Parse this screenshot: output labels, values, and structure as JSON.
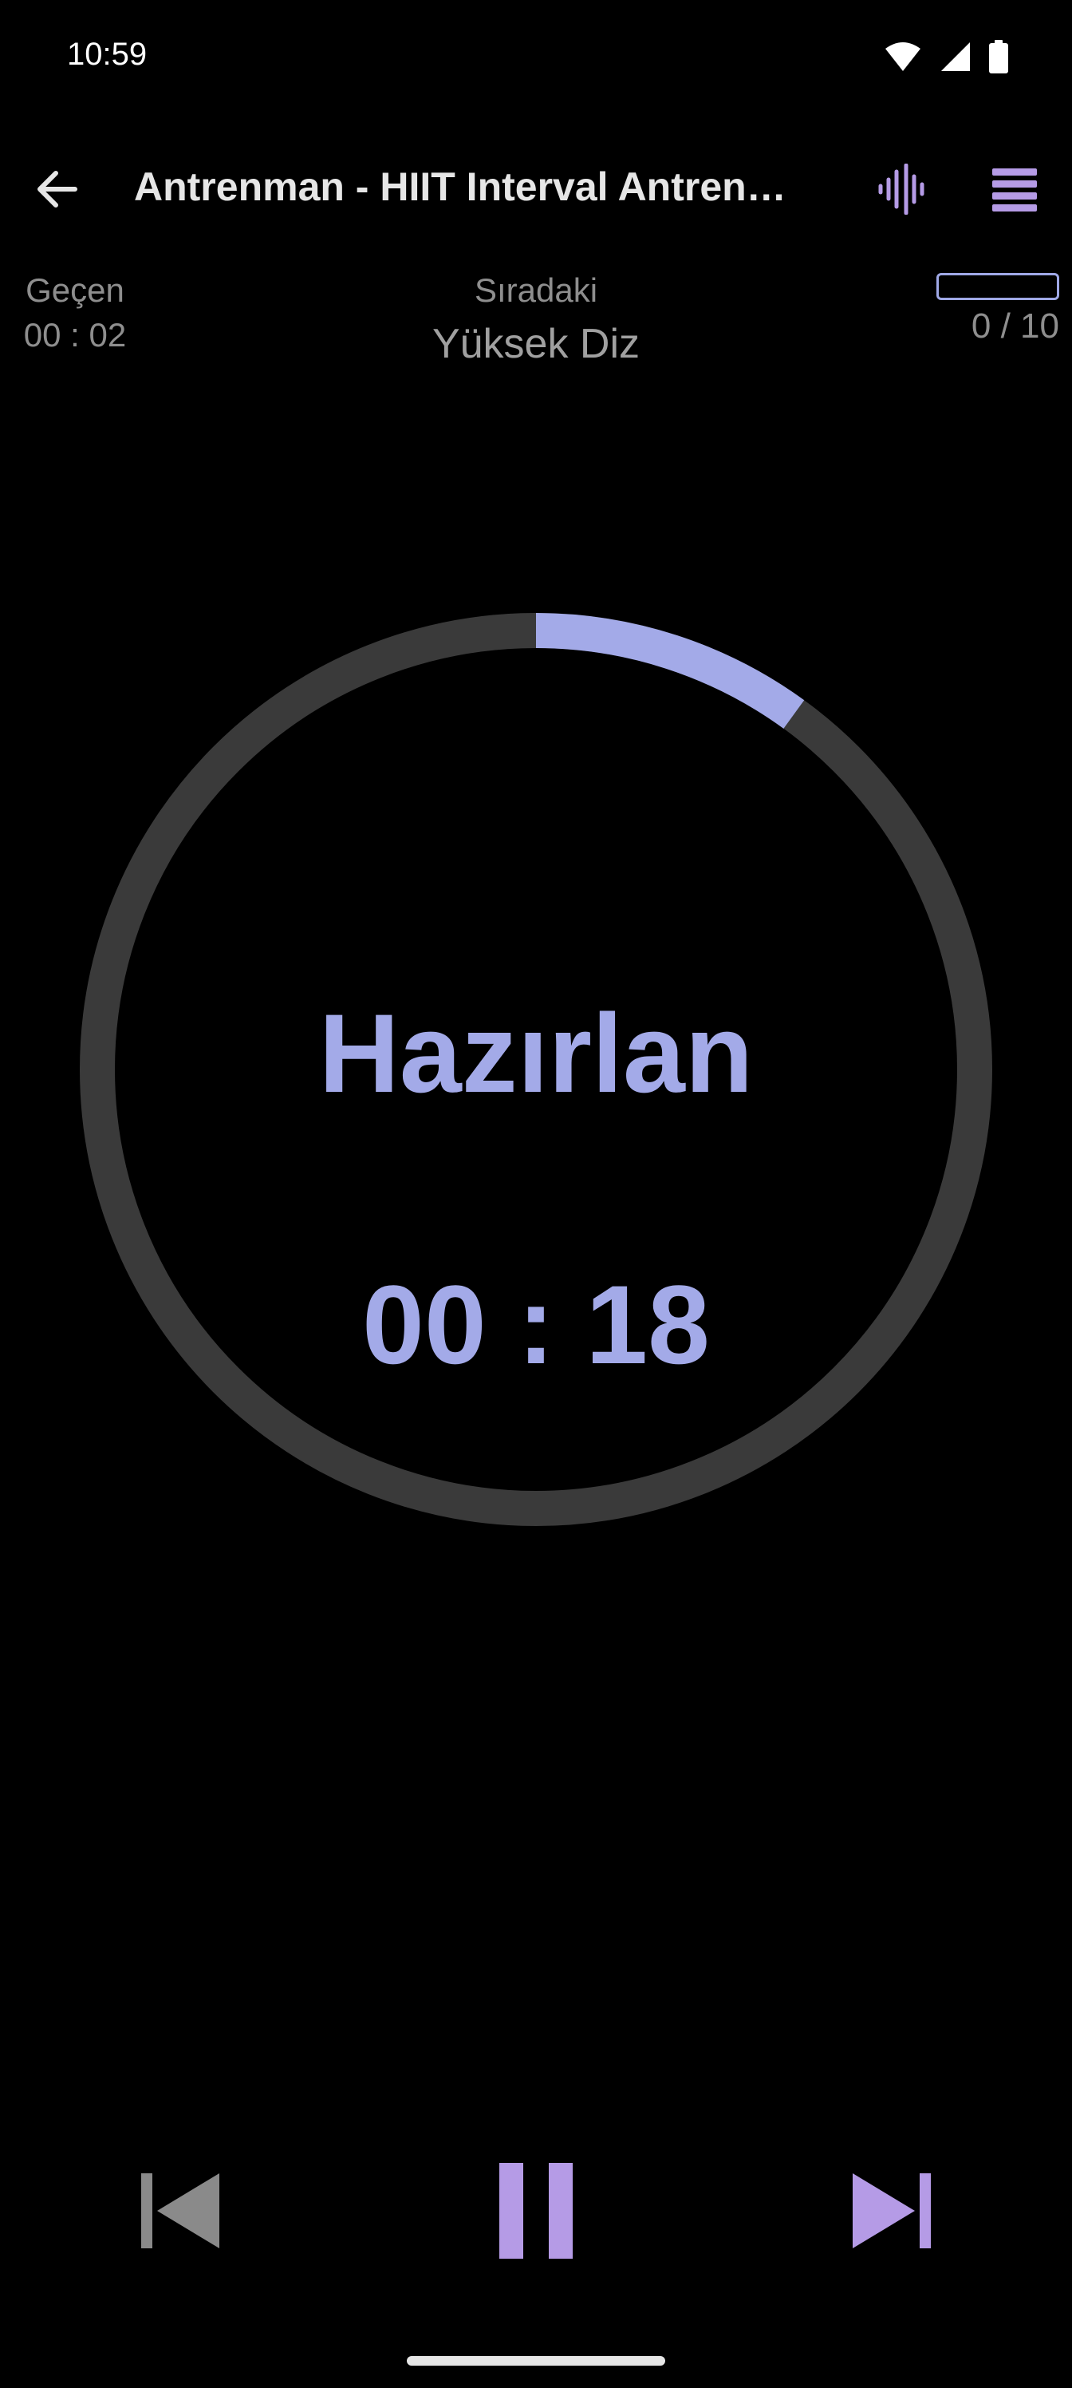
{
  "status_bar": {
    "time": "10:59",
    "icons": [
      "wifi-icon",
      "signal-icon",
      "battery-icon"
    ]
  },
  "app_bar": {
    "title": "Antrenman - HIIT Interval Antrenmanı",
    "back_icon": "arrow-left-icon",
    "sound_icon": "sound-wave-icon",
    "list_icon": "list-icon"
  },
  "info": {
    "elapsed_label": "Geçen",
    "elapsed_value": "00 : 02",
    "next_label": "Sıradaki",
    "next_value": "Yüksek Diz",
    "progress_count": "0 / 10",
    "progress_fraction": 0.0
  },
  "timer": {
    "phase": "Hazırlan",
    "countdown": "00 : 18",
    "ring_progress": 0.1
  },
  "controls": {
    "prev_icon": "skip-previous-icon",
    "pause_icon": "pause-icon",
    "next_icon": "skip-next-icon"
  },
  "colors": {
    "accent": "#a3aae8",
    "accent_purple": "#b59be6",
    "ring_track": "#3a3a3a",
    "muted_text": "#8e8e8e",
    "disabled": "#8a8a8a"
  }
}
